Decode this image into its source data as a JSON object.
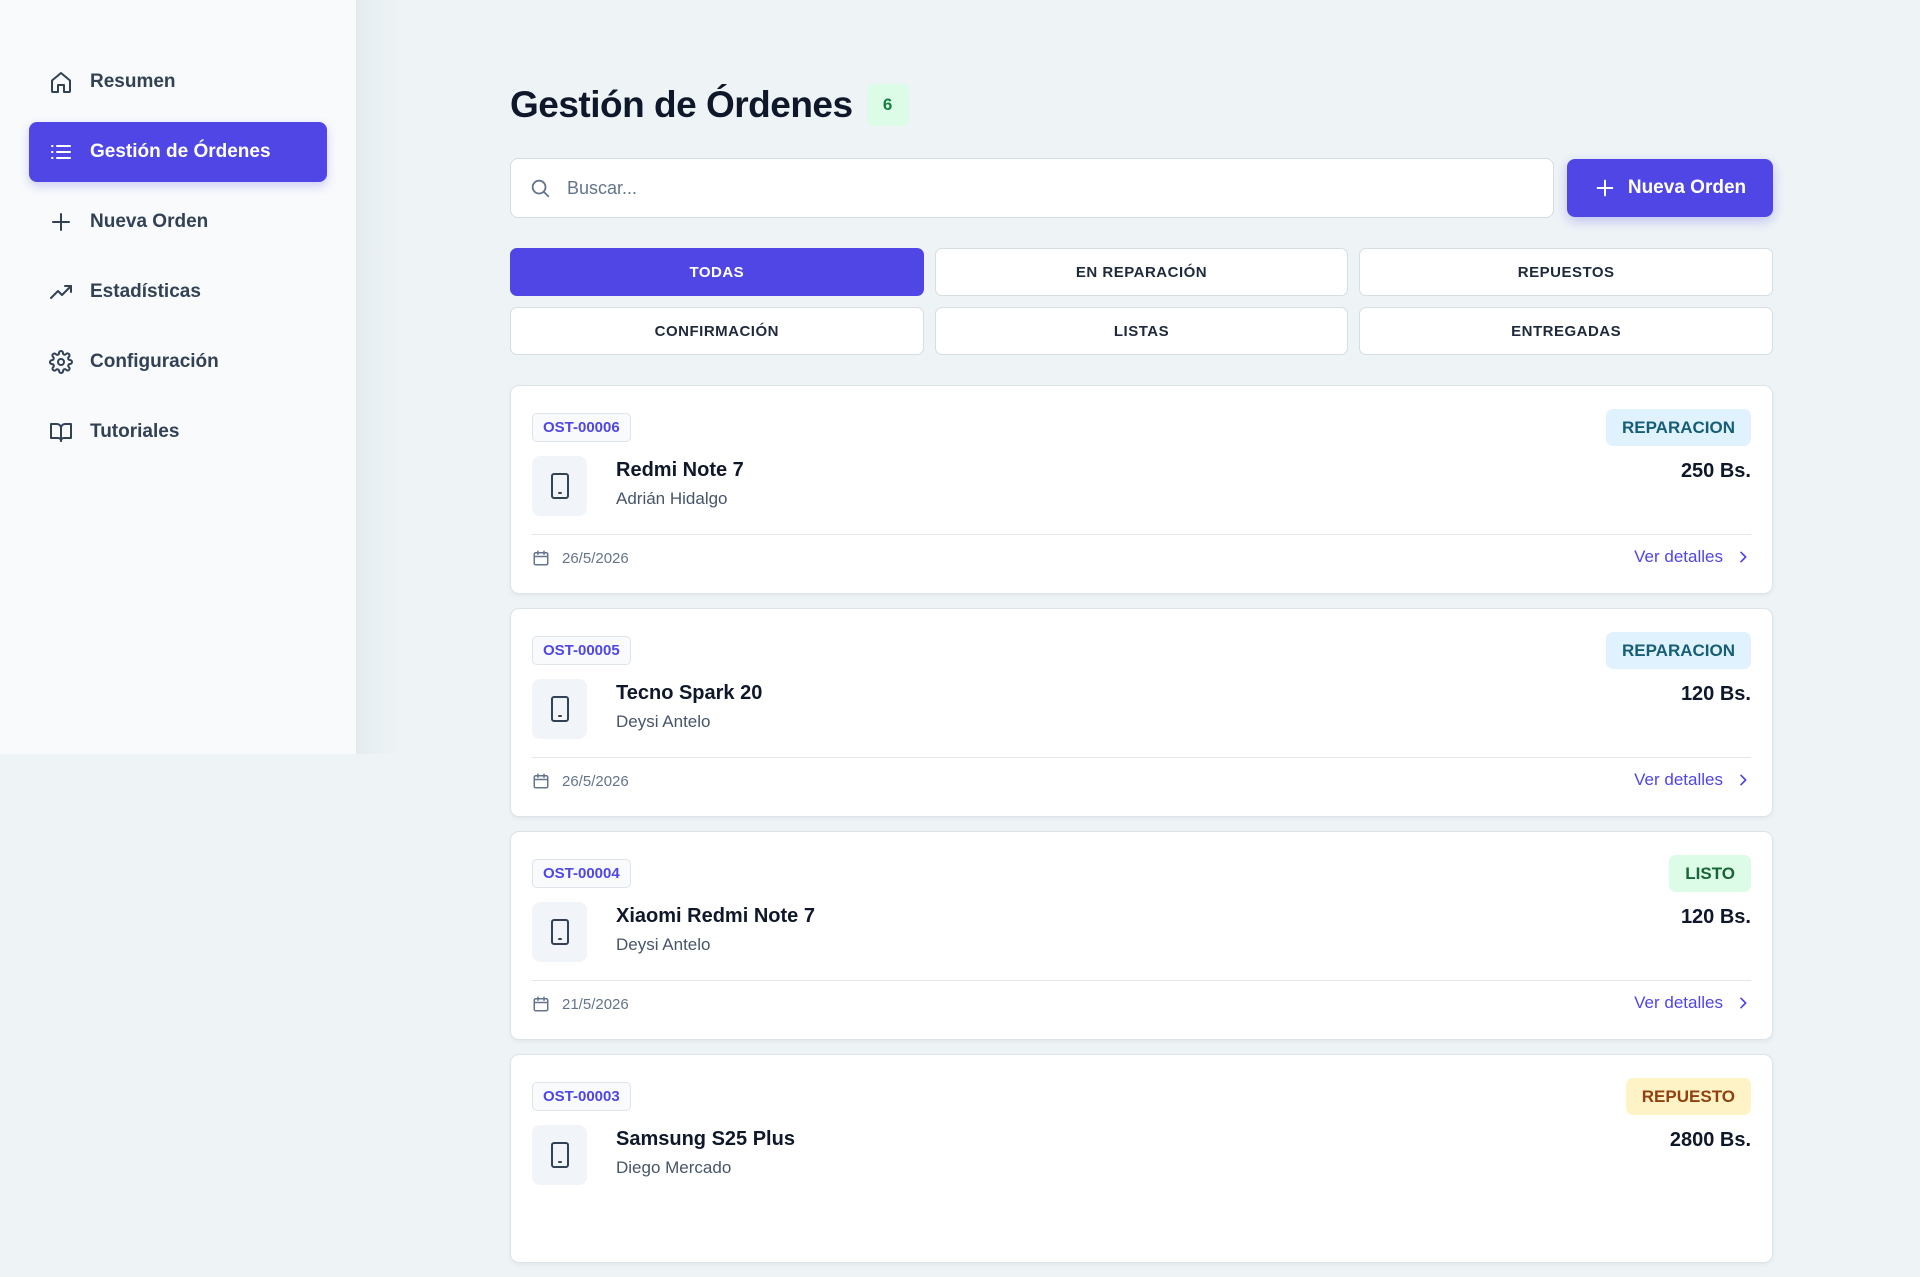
{
  "sidebar": {
    "items": [
      {
        "label": "Resumen",
        "icon": "home-icon",
        "active": false
      },
      {
        "label": "Gestión de Órdenes",
        "icon": "list-icon",
        "active": true
      },
      {
        "label": "Nueva Orden",
        "icon": "plus-icon",
        "active": false
      },
      {
        "label": "Estadísticas",
        "icon": "trending-up-icon",
        "active": false
      },
      {
        "label": "Configuración",
        "icon": "gear-icon",
        "active": false
      },
      {
        "label": "Tutoriales",
        "icon": "book-icon",
        "active": false
      }
    ]
  },
  "header": {
    "title": "Gestión de Órdenes",
    "count": "6"
  },
  "search": {
    "placeholder": "Buscar...",
    "value": ""
  },
  "toolbar": {
    "new_order_label": "Nueva Orden"
  },
  "filters": [
    {
      "label": "TODAS",
      "active": true
    },
    {
      "label": "EN REPARACIÓN",
      "active": false
    },
    {
      "label": "REPUESTOS",
      "active": false
    },
    {
      "label": "CONFIRMACIÓN",
      "active": false
    },
    {
      "label": "LISTAS",
      "active": false
    },
    {
      "label": "ENTREGADAS",
      "active": false
    }
  ],
  "orders": [
    {
      "id": "OST-00006",
      "status": "REPARACION",
      "device": "Redmi Note 7",
      "client": "Adrián Hidalgo",
      "price": "250 Bs.",
      "date": "26/5/2026",
      "details_label": "Ver detalles"
    },
    {
      "id": "OST-00005",
      "status": "REPARACION",
      "device": "Tecno Spark 20",
      "client": "Deysi Antelo",
      "price": "120 Bs.",
      "date": "26/5/2026",
      "details_label": "Ver detalles"
    },
    {
      "id": "OST-00004",
      "status": "LISTO",
      "device": "Xiaomi Redmi Note 7",
      "client": "Deysi Antelo",
      "price": "120 Bs.",
      "date": "21/5/2026",
      "details_label": "Ver detalles"
    },
    {
      "id": "OST-00003",
      "status": "REPUESTO",
      "device": "Samsung S25 Plus",
      "client": "Diego Mercado",
      "price": "2800 Bs.",
      "date": "",
      "details_label": ""
    }
  ],
  "colors": {
    "accent": "#4f46e5",
    "background": "#eef4f6",
    "status_reparacion": "#e0f2fe",
    "status_listo": "#dcfce7",
    "status_repuesto": "#fef3c7"
  }
}
